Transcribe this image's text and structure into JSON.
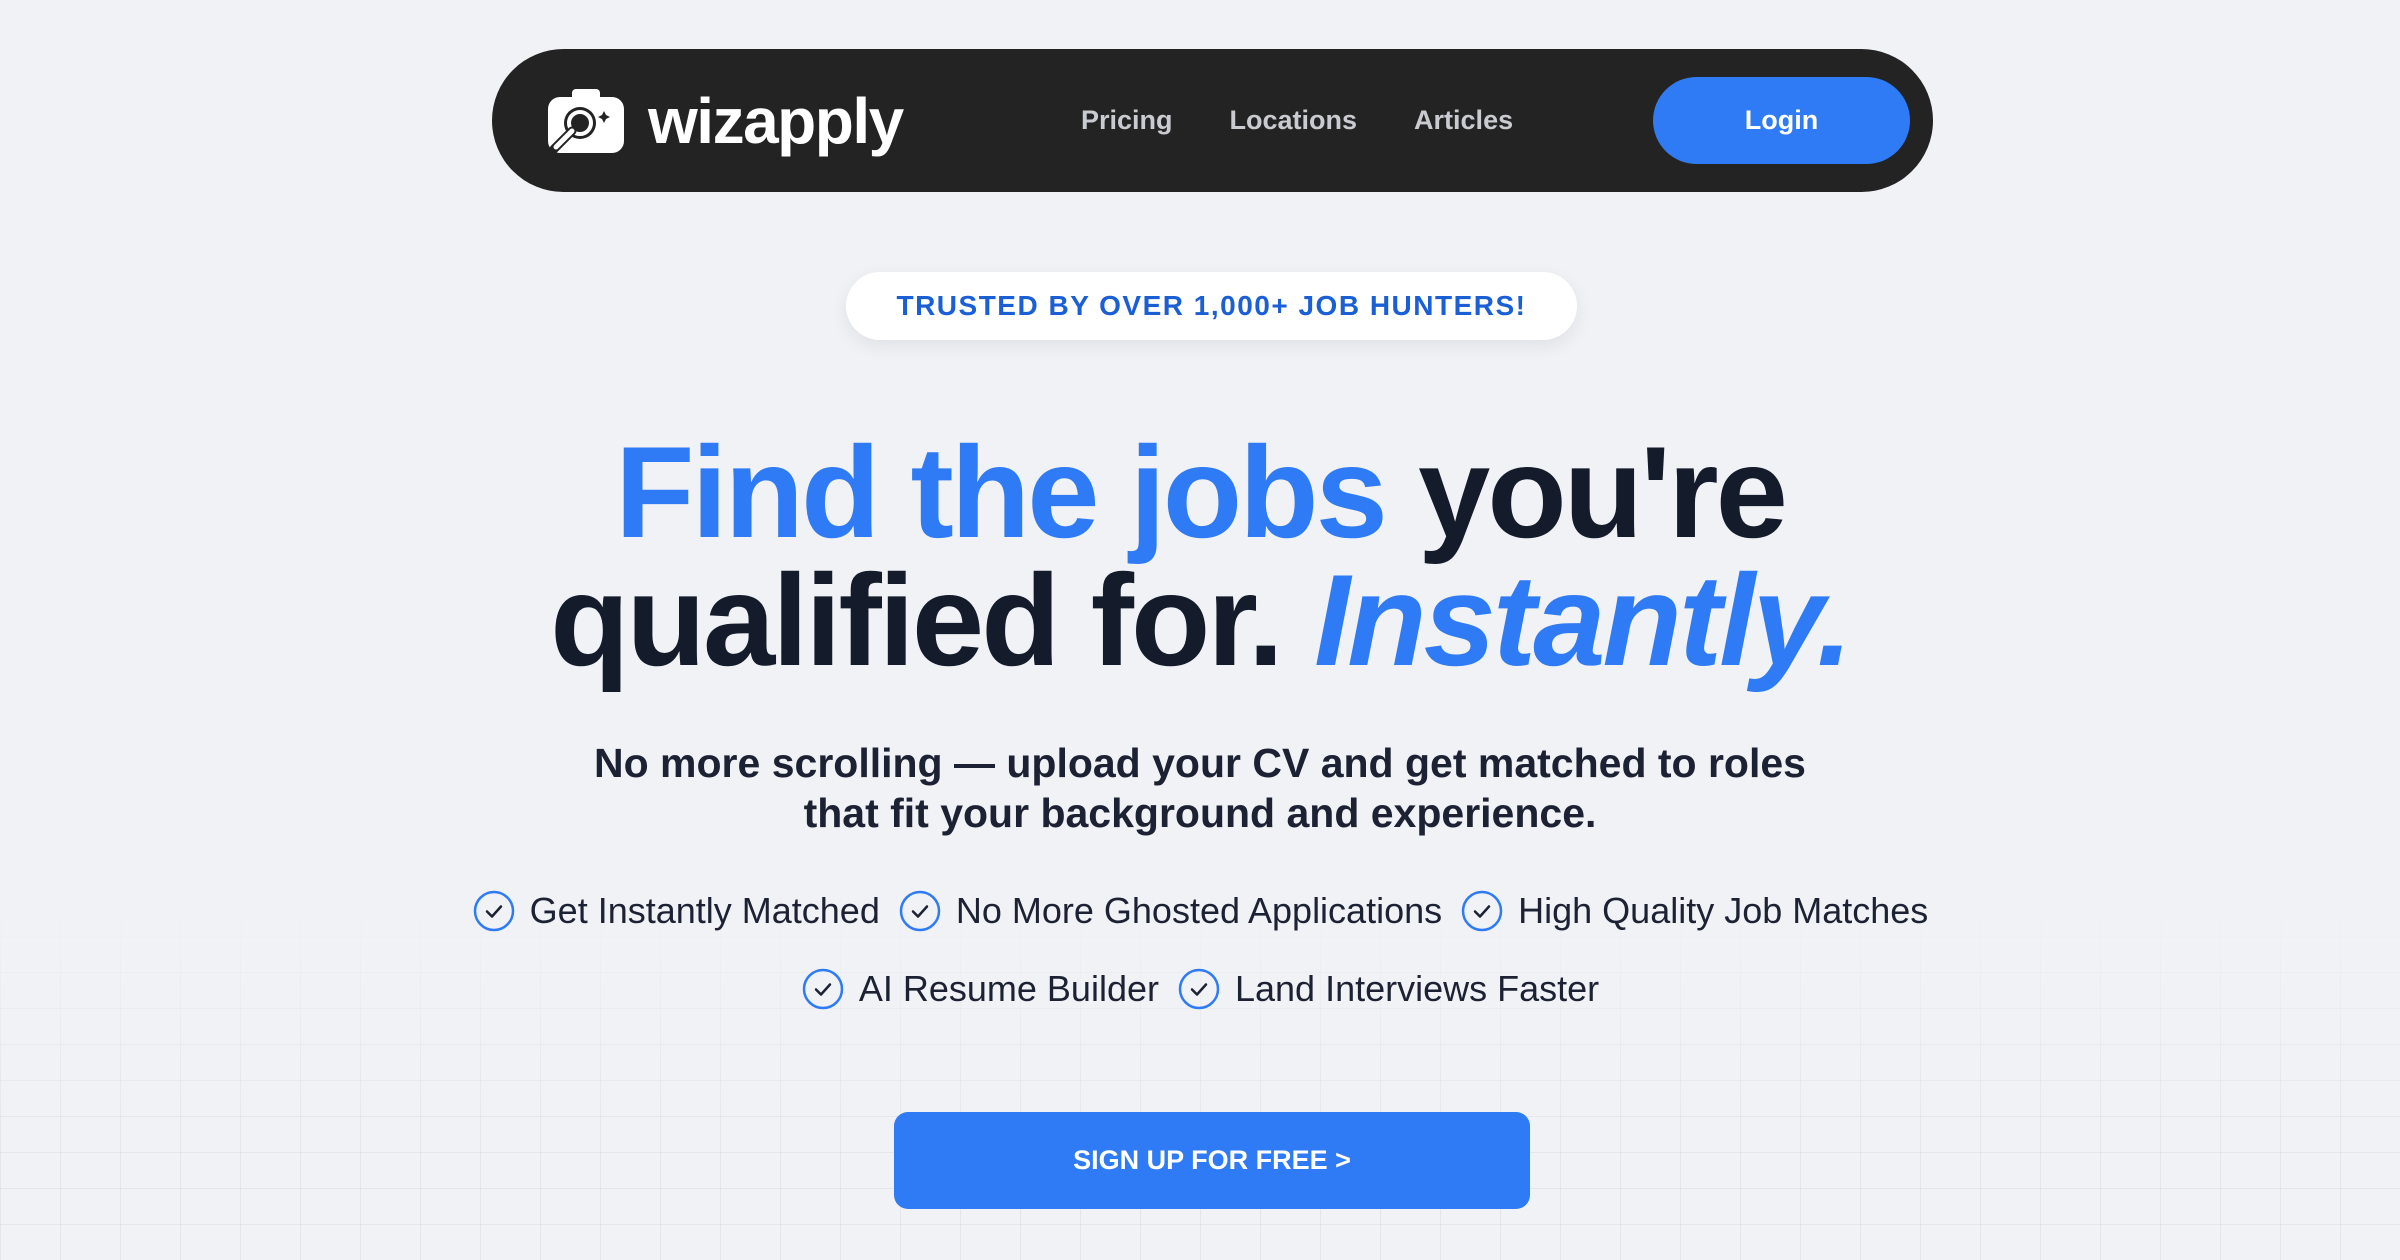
{
  "brand": {
    "name": "wizapply",
    "logo_icon": "camera-magnifier-icon"
  },
  "nav": {
    "links": [
      {
        "label": "Pricing"
      },
      {
        "label": "Locations"
      },
      {
        "label": "Articles"
      }
    ],
    "login_label": "Login"
  },
  "badge": {
    "text": "TRUSTED BY OVER 1,000+ JOB HUNTERS!"
  },
  "hero": {
    "headline_part1": "Find the jobs",
    "headline_part2": "you're",
    "headline_part3": "qualified for.",
    "headline_part4": "Instantly.",
    "subtitle_line1": "No more scrolling — upload your CV and get matched to roles",
    "subtitle_line2": "that fit your background and experience."
  },
  "features": [
    {
      "label": "Get Instantly Matched",
      "icon": "check-circle-icon"
    },
    {
      "label": "No More Ghosted Applications",
      "icon": "check-circle-icon"
    },
    {
      "label": "High Quality Job Matches",
      "icon": "check-circle-icon"
    },
    {
      "label": "AI Resume Builder",
      "icon": "check-circle-icon"
    },
    {
      "label": "Land Interviews Faster",
      "icon": "check-circle-icon"
    }
  ],
  "cta": {
    "label": "SIGN UP FOR FREE >"
  },
  "colors": {
    "accent": "#2f7bf6",
    "nav_bg": "#232323",
    "background": "#f0f2f5",
    "headline_dark": "#141b2b",
    "badge_text": "#1a5fd6"
  }
}
